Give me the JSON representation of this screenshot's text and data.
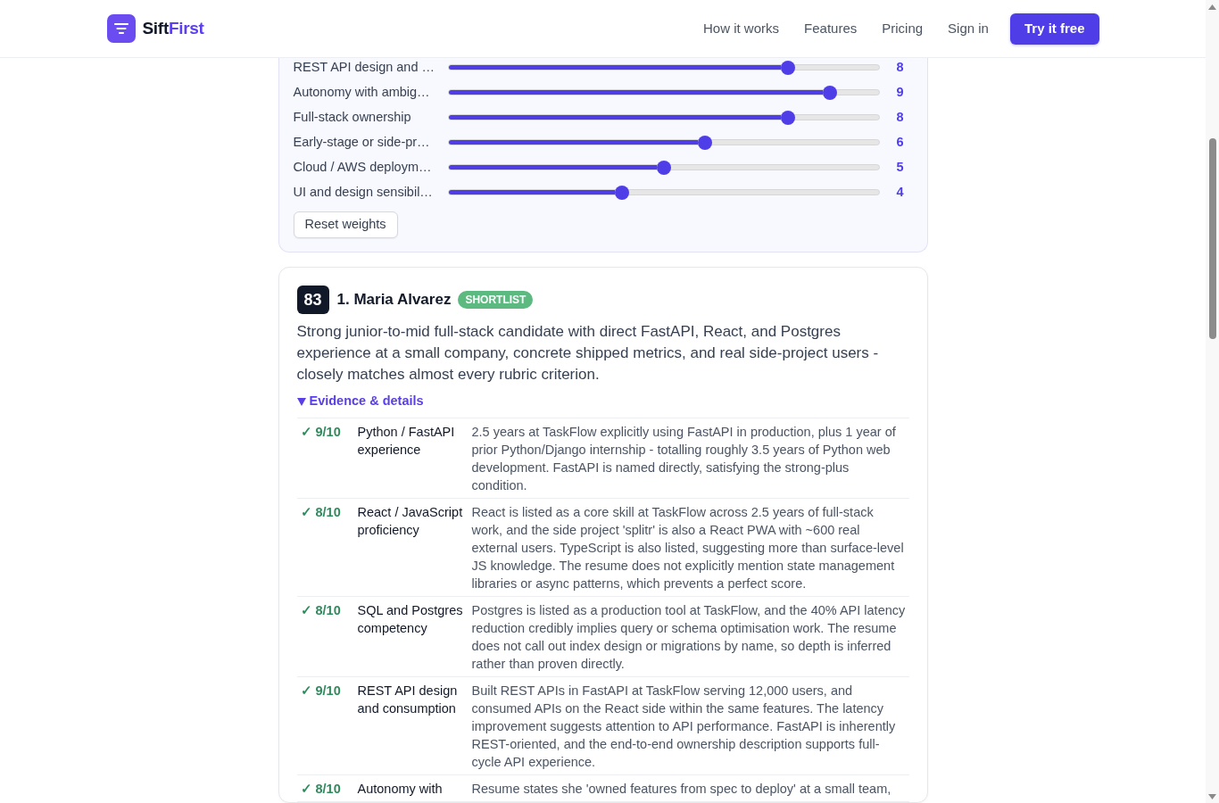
{
  "header": {
    "brand": {
      "parts": [
        {
          "text": "Sift",
          "kind": "plain"
        },
        {
          "text": "First",
          "kind": "accent"
        }
      ]
    },
    "nav_links": [
      "How it works",
      "Features",
      "Pricing",
      "Sign in"
    ],
    "cta_button": "Try it free"
  },
  "weights_panel": {
    "sliders": [
      {
        "label": "REST API design and …",
        "level": 0.8,
        "reading": "8"
      },
      {
        "label": "Autonomy with ambig…",
        "level": 0.9,
        "reading": "9"
      },
      {
        "label": "Full-stack ownership",
        "level": 0.8,
        "reading": "8"
      },
      {
        "label": "Early-stage or side-pr…",
        "level": 0.6,
        "reading": "6"
      },
      {
        "label": "Cloud / AWS deploym…",
        "level": 0.5,
        "reading": "5"
      },
      {
        "label": "UI and design sensibil…",
        "level": 0.4,
        "reading": "4"
      }
    ],
    "reset_button": "Reset weights"
  },
  "candidates": [
    {
      "score": "83",
      "name": "1. Maria Alvarez",
      "status": {
        "label": "SHORTLIST",
        "kind": "shortlist"
      },
      "summary": "Strong junior-to-mid full-stack candidate with direct FastAPI, React, and Postgres experience at a small company, concrete shipped metrics, and real side-project users - closely matches almost every rubric criterion.",
      "details": {
        "label": "Evidence & details",
        "expanded": true
      },
      "criteria": [
        {
          "score": "✓ 9/10",
          "name": "Python / FastAPI experience",
          "evidence": "2.5 years at TaskFlow explicitly using FastAPI in production, plus 1 year of prior Python/Django internship - totalling roughly 3.5 years of Python web development. FastAPI is named directly, satisfying the strong-plus condition."
        },
        {
          "score": "✓ 8/10",
          "name": "React / JavaScript proficiency",
          "evidence": "React is listed as a core skill at TaskFlow across 2.5 years of full-stack work, and the side project 'splitr' is also a React PWA with ~600 real external users. TypeScript is also listed, suggesting more than surface-level JS knowledge. The resume does not explicitly mention state management libraries or async patterns, which prevents a perfect score."
        },
        {
          "score": "✓ 8/10",
          "name": "SQL and Postgres competency",
          "evidence": "Postgres is listed as a production tool at TaskFlow, and the 40% API latency reduction credibly implies query or schema optimisation work. The resume does not call out index design or migrations by name, so depth is inferred rather than proven directly."
        },
        {
          "score": "✓ 9/10",
          "name": "REST API design and consumption",
          "evidence": "Built REST APIs in FastAPI at TaskFlow serving 12,000 users, and consumed APIs on the React side within the same features. The latency improvement suggests attention to API performance. FastAPI is inherently REST-oriented, and the end-to-end ownership description supports full-cycle API experience."
        },
        {
          "score": "✓ 8/10",
          "name": "Autonomy with",
          "evidence": "Resume states she 'owned features from spec to deploy' at a small team,"
        }
      ]
    }
  ]
}
